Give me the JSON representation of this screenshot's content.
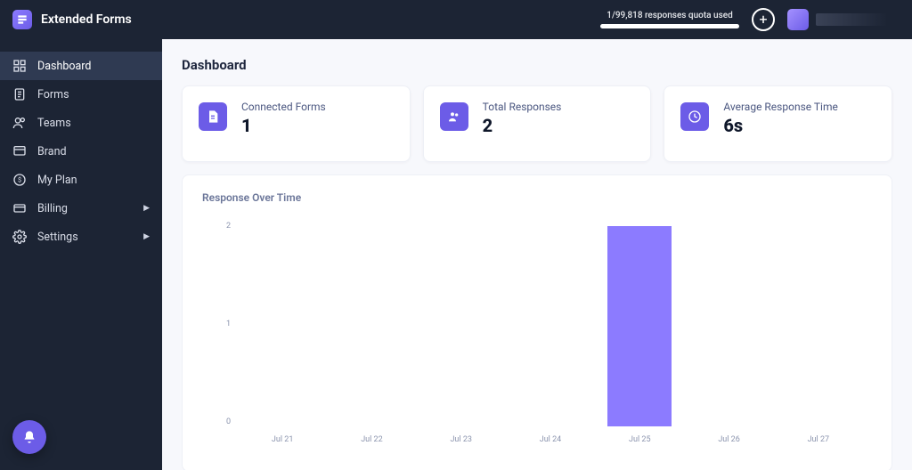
{
  "brand": {
    "name": "Extended Forms"
  },
  "header": {
    "quota_text": "1/99,818 responses quota used",
    "user_name": ""
  },
  "sidebar": {
    "items": [
      {
        "label": "Dashboard",
        "icon": "dashboard-icon",
        "active": true,
        "expandable": false
      },
      {
        "label": "Forms",
        "icon": "forms-icon",
        "active": false,
        "expandable": false
      },
      {
        "label": "Teams",
        "icon": "teams-icon",
        "active": false,
        "expandable": false
      },
      {
        "label": "Brand",
        "icon": "brand-icon",
        "active": false,
        "expandable": false
      },
      {
        "label": "My Plan",
        "icon": "plan-icon",
        "active": false,
        "expandable": false
      },
      {
        "label": "Billing",
        "icon": "billing-icon",
        "active": false,
        "expandable": true
      },
      {
        "label": "Settings",
        "icon": "settings-icon",
        "active": false,
        "expandable": true
      }
    ]
  },
  "page": {
    "title": "Dashboard"
  },
  "stats": {
    "connected_forms": {
      "label": "Connected Forms",
      "value": "1"
    },
    "total_responses": {
      "label": "Total Responses",
      "value": "2"
    },
    "avg_response_time": {
      "label": "Average Response Time",
      "value": "6s"
    }
  },
  "chart_title": "Response Over Time",
  "chart_data": {
    "type": "bar",
    "categories": [
      "Jul 21",
      "Jul 22",
      "Jul 23",
      "Jul 24",
      "Jul 25",
      "Jul 26",
      "Jul 27"
    ],
    "values": [
      0,
      0,
      0,
      0,
      2,
      0,
      0
    ],
    "title": "Response Over Time",
    "xlabel": "",
    "ylabel": "",
    "ylim": [
      0,
      2
    ],
    "yticks": [
      2,
      1,
      0
    ]
  },
  "colors": {
    "accent": "#6c5ce7",
    "bar": "#8c7bff"
  }
}
